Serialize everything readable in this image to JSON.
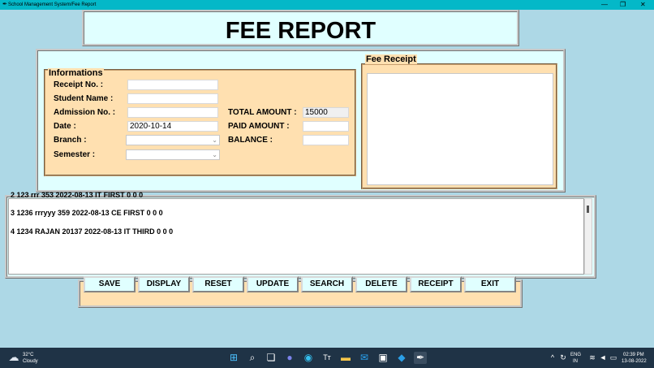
{
  "window": {
    "title": "School Management System/Fee Report",
    "minimize": "—",
    "maximize": "❐",
    "close": "✕"
  },
  "header": {
    "title": "FEE REPORT"
  },
  "info": {
    "legend": "Informations",
    "receipt_label": "Receipt No. :",
    "receipt_value": "",
    "student_label": "Student Name :",
    "student_value": "",
    "admission_label": "Admission No. :",
    "admission_value": "",
    "date_label": "Date :",
    "date_value": "2020-10-14",
    "branch_label": "Branch :",
    "branch_value": "",
    "semester_label": "Semester :",
    "semester_value": "",
    "total_label": "TOTAL AMOUNT :",
    "total_value": "15000",
    "paid_label": "PAID AMOUNT :",
    "paid_value": "",
    "balance_label": "BALANCE :",
    "balance_value": ""
  },
  "receipt": {
    "legend": "Fee Receipt",
    "content": ""
  },
  "records": [
    "2 123 rrr 353 2022-08-13 IT FIRST 0 0 0",
    "3 1236 rrryyy 359 2022-08-13 CE FIRST 0 0 0",
    "4 1234 RAJAN 20137 2022-08-13 IT THIRD 0 0 0"
  ],
  "buttons": {
    "save": "SAVE",
    "display": "DISPLAY",
    "reset": "RESET",
    "update": "UPDATE",
    "search": "SEARCH",
    "delete": "DELETE",
    "receipt": "RECEIPT",
    "exit": "EXIT"
  },
  "taskbar": {
    "weather_temp": "32°C",
    "weather_desc": "Cloudy",
    "lang_top": "ENG",
    "lang_bottom": "IN",
    "time": "02:39 PM",
    "date": "13-08-2022",
    "icons": [
      "start-icon",
      "search-icon",
      "task-view-icon",
      "teams-icon",
      "edge-icon",
      "text-icon",
      "file-explorer-icon",
      "mail-icon",
      "store-icon",
      "vscode-icon",
      "python-icon"
    ]
  },
  "colors": {
    "background": "#add8e6",
    "panel": "#e0ffff",
    "frame": "#ffe0b0",
    "titlebar": "#04b8c8",
    "taskbar": "#1f3346"
  }
}
